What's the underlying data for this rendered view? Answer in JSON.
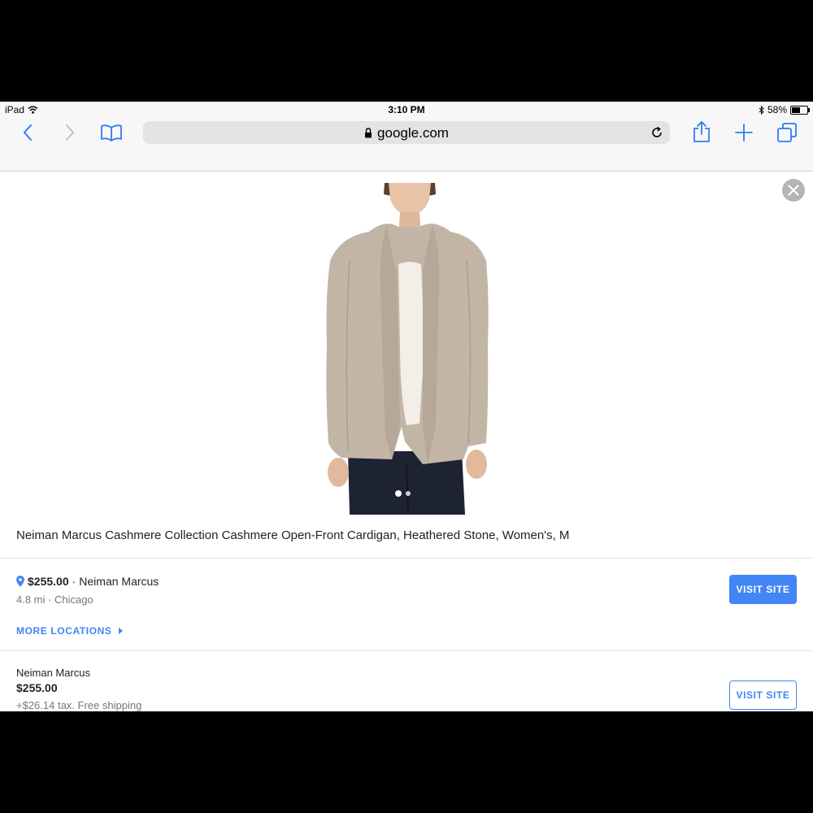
{
  "status_bar": {
    "device": "iPad",
    "time": "3:10 PM",
    "battery_text": "58%",
    "battery_level": 0.58
  },
  "browser": {
    "url": "google.com",
    "icons": [
      "back-icon",
      "forward-icon",
      "bookmarks-icon",
      "lock-icon",
      "reload-icon",
      "share-icon",
      "new-tab-icon",
      "tabs-icon"
    ],
    "accent": "#2f7cf6"
  },
  "product": {
    "title": "Neiman Marcus Cashmere Collection Cashmere Open-Front Cardigan, Heathered Stone, Women's, M",
    "image_count": 2,
    "active_image": 1
  },
  "local_offer": {
    "price": "$255.00",
    "store": "Neiman Marcus",
    "separator": "·",
    "distance_city": "4.8 mi · Chicago",
    "visit_label": "VISIT SITE",
    "more_locations_label": "MORE LOCATIONS"
  },
  "online_offer": {
    "seller": "Neiman Marcus",
    "price": "$255.00",
    "shipping": "+$26.14 tax. Free shipping",
    "visit_label": "VISIT SITE"
  },
  "colors": {
    "link_blue": "#4285f4",
    "button_blue": "#4285f4"
  }
}
